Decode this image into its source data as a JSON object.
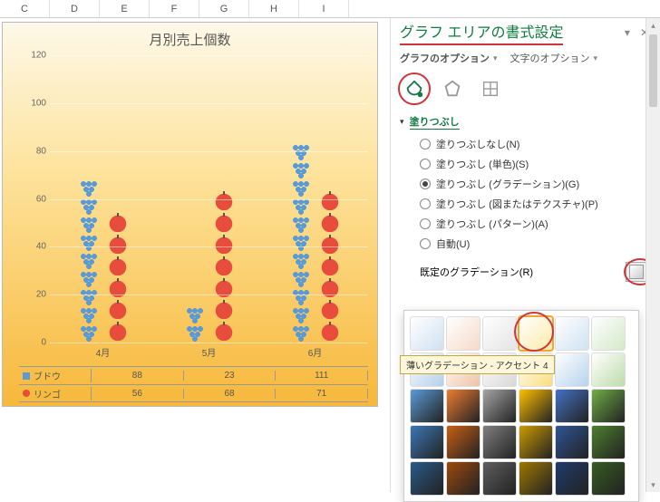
{
  "columns": [
    "C",
    "D",
    "E",
    "F",
    "G",
    "H",
    "I"
  ],
  "chart_data": {
    "type": "bar",
    "title": "月別売上個数",
    "categories": [
      "4月",
      "5月",
      "6月"
    ],
    "series": [
      {
        "name": "ブドウ",
        "values": [
          88,
          23,
          111
        ],
        "icon_per_unit": 10
      },
      {
        "name": "リンゴ",
        "values": [
          56,
          68,
          71
        ],
        "icon_per_unit": 10
      }
    ],
    "ylabel": "",
    "ylim": [
      0,
      120
    ],
    "y_ticks": [
      0,
      20,
      40,
      60,
      80,
      100,
      120
    ]
  },
  "pane": {
    "title": "グラフ エリアの書式設定",
    "opt_tabs": {
      "chart": "グラフのオプション",
      "text": "文字のオプション"
    },
    "section": "塗りつぶし",
    "fill_options": [
      {
        "label": "塗りつぶしなし(N)",
        "selected": false
      },
      {
        "label": "塗りつぶし (単色)(S)",
        "selected": false
      },
      {
        "label": "塗りつぶし (グラデーション)(G)",
        "selected": true
      },
      {
        "label": "塗りつぶし (図またはテクスチャ)(P)",
        "selected": false
      },
      {
        "label": "塗りつぶし (パターン)(A)",
        "selected": false
      },
      {
        "label": "自動(U)",
        "selected": false
      }
    ],
    "preset_label": "既定のグラデーション(R)",
    "tooltip": "薄いグラデーション - アクセント 4",
    "palette": {
      "cols": 6,
      "rows": [
        [
          "#cfe0f2",
          "#f5d9c9",
          "#e4e4e4",
          "#fdeaa7",
          "#cfe2f3",
          "#d4e8c9"
        ],
        [
          "#b3cfea",
          "#efc2a5",
          "#d8d8d8",
          "#fbdd7e",
          "#b7d3ee",
          "#bddca9"
        ],
        [
          "#5b9bd5",
          "#ed7d31",
          "#a5a5a5",
          "#ffc000",
          "#4472c4",
          "#70ad47"
        ],
        [
          "#3b78b5",
          "#c85f12",
          "#7f7f7f",
          "#cc9a00",
          "#2e5597",
          "#4d7f2f"
        ],
        [
          "#2a5a8a",
          "#9c490e",
          "#5e5e5e",
          "#9e7700",
          "#203b6c",
          "#375c22"
        ]
      ],
      "highlighted": {
        "row": 0,
        "col": 3
      }
    }
  }
}
